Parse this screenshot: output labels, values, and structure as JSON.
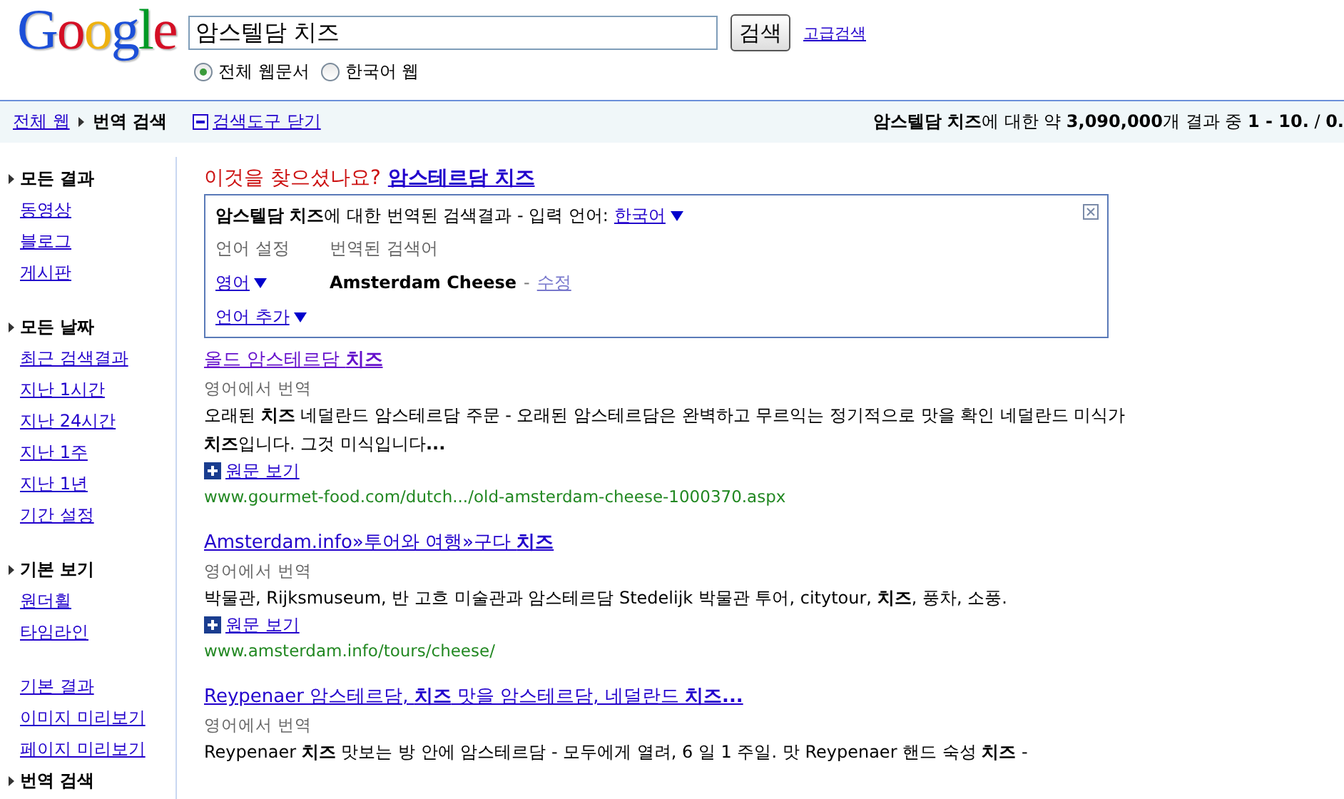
{
  "logo": {
    "text": "Google"
  },
  "search": {
    "value": "암스텔담 치즈",
    "button": "검색",
    "advanced_link": "고급검색"
  },
  "scopes": [
    {
      "label": "전체 웹문서",
      "selected": true
    },
    {
      "label": "한국어 웹",
      "selected": false
    }
  ],
  "toolbar": {
    "breadcrumb": [
      {
        "label": "전체 웹",
        "kind": "link"
      },
      {
        "label": "번역 검색",
        "kind": "current"
      }
    ],
    "tools_link": "검색도구 닫기",
    "result_stats": "**암스텔담 치즈**에 대한 약 **3,090,000**개 결과 중 **1 - 10.** / **0.**"
  },
  "sidebar": {
    "sections": [
      {
        "items": [
          {
            "kind": "heading",
            "label": "모든 결과"
          },
          {
            "kind": "link",
            "label": "동영상"
          },
          {
            "kind": "link",
            "label": "블로그"
          },
          {
            "kind": "link",
            "label": "게시판"
          }
        ]
      },
      {
        "items": [
          {
            "kind": "heading",
            "label": "모든 날짜"
          },
          {
            "kind": "link",
            "label": "최근 검색결과"
          },
          {
            "kind": "link",
            "label": "지난 1시간"
          },
          {
            "kind": "link",
            "label": "지난 24시간"
          },
          {
            "kind": "link",
            "label": "지난 1주"
          },
          {
            "kind": "link",
            "label": "지난 1년"
          },
          {
            "kind": "link",
            "label": "기간 설정"
          }
        ]
      },
      {
        "items": [
          {
            "kind": "heading",
            "label": "기본 보기"
          },
          {
            "kind": "link",
            "label": "원더휠"
          },
          {
            "kind": "link",
            "label": "타임라인"
          }
        ]
      },
      {
        "items": [
          {
            "kind": "link",
            "label": "기본 결과"
          },
          {
            "kind": "link",
            "label": "이미지 미리보기"
          },
          {
            "kind": "link",
            "label": "페이지 미리보기"
          },
          {
            "kind": "heading",
            "label": "번역 검색"
          }
        ]
      }
    ]
  },
  "did_you_mean": {
    "prompt": "이것을 찾으셨나요?",
    "suggestion": "암스테르담 치즈"
  },
  "translation_box": {
    "title": "**암스텔담 치즈**에 대한 번역된 검색결과 - 입력 언어:",
    "input_language": "한국어",
    "column_headers": [
      "언어 설정",
      "번역된 검색어"
    ],
    "language": "영어",
    "translated_query": "Amsterdam Cheese",
    "separator": "-",
    "edit_link": "수정",
    "add_language": "언어 추가"
  },
  "results": [
    {
      "title": "올드 암스테르담 **치즈**",
      "visited": true,
      "source": "영어에서 번역",
      "snippet": "오래된 **치즈** 네덜란드 암스테르담 주문 - 오래된 암스테르담은 완벽하고 무르익는 정기적으로 맛을 확인 네덜란드 미식가 **치즈**입니다. 그것 미식입니다**...**",
      "original_link": "원문 보기",
      "url": "www.gourmet-food.com/dutch.../old-amsterdam-cheese-1000370.aspx"
    },
    {
      "title": "Amsterdam.info»투어와 여행»구다 **치즈**",
      "visited": false,
      "source": "영어에서 번역",
      "snippet": "박물관, Rijksmuseum, 반 고흐 미술관과 암스테르담 Stedelijk 박물관 투어, citytour, **치즈**, 풍차, 소풍.",
      "original_link": "원문 보기",
      "url": "www.amsterdam.info/tours/cheese/"
    },
    {
      "title": "Reypenaer 암스테르담, **치즈** 맛을 암스테르담, 네덜란드 **치즈...**",
      "visited": false,
      "source": "영어에서 번역",
      "snippet": "Reypenaer **치즈** 맛보는 방 안에 암스테르담 - 모두에게 열려, 6 일 1 주일. 맛 Reypenaer 핸드 숙성 **치즈** -"
    }
  ]
}
